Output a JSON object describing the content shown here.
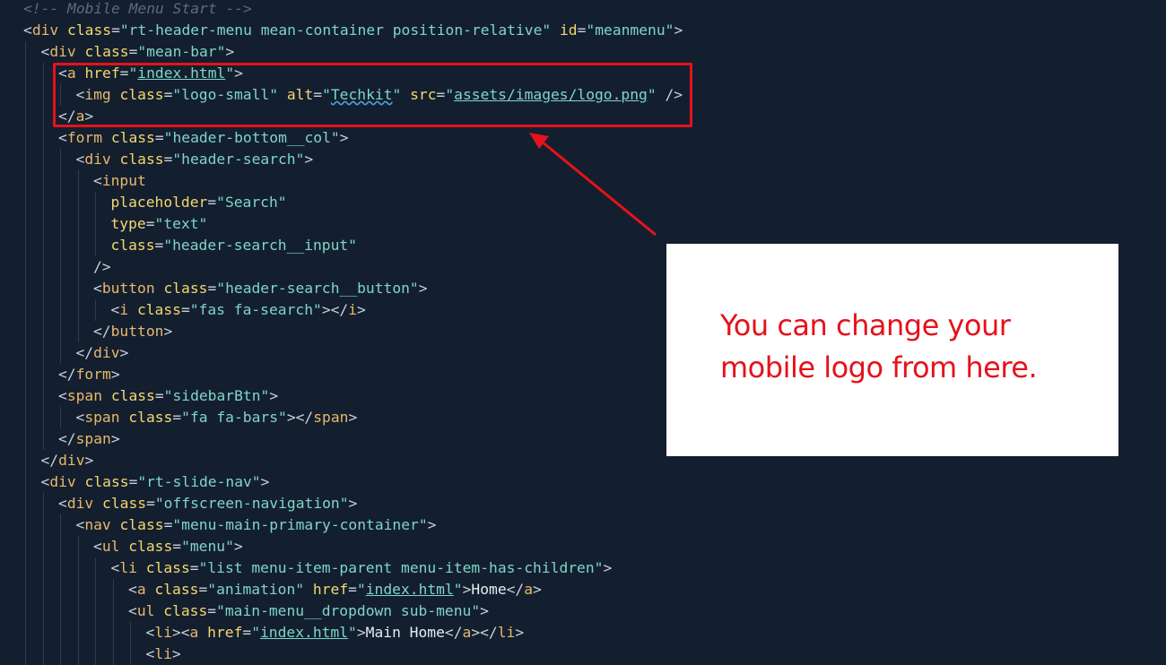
{
  "colors": {
    "background": "#131f2f",
    "tag": "#e8b86a",
    "attribute": "#f5d76e",
    "string": "#7fd5c8",
    "comment": "#5c6b7f",
    "annotation": "#e5121b",
    "callout_bg": "#ffffff"
  },
  "callout": {
    "line1": "You can change your",
    "line2": "mobile logo from here."
  },
  "code_lines": [
    {
      "indent": 0,
      "tokens": [
        [
          "cm",
          "<!-- Mobile Menu Start -->"
        ]
      ]
    },
    {
      "indent": 0,
      "tokens": [
        [
          "pu",
          "<"
        ],
        [
          "tg",
          "div"
        ],
        [
          "pu",
          " "
        ],
        [
          "at",
          "class"
        ],
        [
          "pu",
          "="
        ],
        [
          "st",
          "\"rt-header-menu mean-container position-relative\""
        ],
        [
          "pu",
          " "
        ],
        [
          "at",
          "id"
        ],
        [
          "pu",
          "="
        ],
        [
          "st",
          "\"meanmenu\""
        ],
        [
          "pu",
          ">"
        ]
      ]
    },
    {
      "indent": 1,
      "tokens": [
        [
          "pu",
          "<"
        ],
        [
          "tg",
          "div"
        ],
        [
          "pu",
          " "
        ],
        [
          "at",
          "class"
        ],
        [
          "pu",
          "="
        ],
        [
          "st",
          "\"mean-bar\""
        ],
        [
          "pu",
          ">"
        ]
      ]
    },
    {
      "indent": 2,
      "tokens": [
        [
          "pu",
          "<"
        ],
        [
          "tg",
          "a"
        ],
        [
          "pu",
          " "
        ],
        [
          "at",
          "href"
        ],
        [
          "pu",
          "="
        ],
        [
          "st",
          "\""
        ],
        [
          "st ul",
          "index.html"
        ],
        [
          "st",
          "\""
        ],
        [
          "pu",
          ">"
        ]
      ]
    },
    {
      "indent": 3,
      "tokens": [
        [
          "pu",
          "<"
        ],
        [
          "tg",
          "img"
        ],
        [
          "pu",
          " "
        ],
        [
          "at",
          "class"
        ],
        [
          "pu",
          "="
        ],
        [
          "st",
          "\"logo-small\""
        ],
        [
          "pu",
          " "
        ],
        [
          "at",
          "alt"
        ],
        [
          "pu",
          "="
        ],
        [
          "st",
          "\""
        ],
        [
          "st sq",
          "Techkit"
        ],
        [
          "st",
          "\""
        ],
        [
          "pu",
          " "
        ],
        [
          "at",
          "src"
        ],
        [
          "pu",
          "="
        ],
        [
          "st",
          "\""
        ],
        [
          "st ul",
          "assets/images/logo.png"
        ],
        [
          "st",
          "\""
        ],
        [
          "pu",
          " />"
        ]
      ]
    },
    {
      "indent": 2,
      "tokens": [
        [
          "pu",
          "</"
        ],
        [
          "tg",
          "a"
        ],
        [
          "pu",
          ">"
        ]
      ]
    },
    {
      "indent": 2,
      "tokens": [
        [
          "pu",
          "<"
        ],
        [
          "tg",
          "form"
        ],
        [
          "pu",
          " "
        ],
        [
          "at",
          "class"
        ],
        [
          "pu",
          "="
        ],
        [
          "st",
          "\"header-bottom__col\""
        ],
        [
          "pu",
          ">"
        ]
      ]
    },
    {
      "indent": 3,
      "tokens": [
        [
          "pu",
          "<"
        ],
        [
          "tg",
          "div"
        ],
        [
          "pu",
          " "
        ],
        [
          "at",
          "class"
        ],
        [
          "pu",
          "="
        ],
        [
          "st",
          "\"header-search\""
        ],
        [
          "pu",
          ">"
        ]
      ]
    },
    {
      "indent": 4,
      "tokens": [
        [
          "pu",
          "<"
        ],
        [
          "tg",
          "input"
        ]
      ]
    },
    {
      "indent": 5,
      "tokens": [
        [
          "at",
          "placeholder"
        ],
        [
          "pu",
          "="
        ],
        [
          "st",
          "\"Search\""
        ]
      ]
    },
    {
      "indent": 5,
      "tokens": [
        [
          "at",
          "type"
        ],
        [
          "pu",
          "="
        ],
        [
          "st",
          "\"text\""
        ]
      ]
    },
    {
      "indent": 5,
      "tokens": [
        [
          "at",
          "class"
        ],
        [
          "pu",
          "="
        ],
        [
          "st",
          "\"header-search__input\""
        ]
      ]
    },
    {
      "indent": 4,
      "tokens": [
        [
          "pu",
          "/>"
        ]
      ]
    },
    {
      "indent": 4,
      "tokens": [
        [
          "pu",
          "<"
        ],
        [
          "tg",
          "button"
        ],
        [
          "pu",
          " "
        ],
        [
          "at",
          "class"
        ],
        [
          "pu",
          "="
        ],
        [
          "st",
          "\"header-search__button\""
        ],
        [
          "pu",
          ">"
        ]
      ]
    },
    {
      "indent": 5,
      "tokens": [
        [
          "pu",
          "<"
        ],
        [
          "tg",
          "i"
        ],
        [
          "pu",
          " "
        ],
        [
          "at",
          "class"
        ],
        [
          "pu",
          "="
        ],
        [
          "st",
          "\"fas fa-search\""
        ],
        [
          "pu",
          "></"
        ],
        [
          "tg",
          "i"
        ],
        [
          "pu",
          ">"
        ]
      ]
    },
    {
      "indent": 4,
      "tokens": [
        [
          "pu",
          "</"
        ],
        [
          "tg",
          "button"
        ],
        [
          "pu",
          ">"
        ]
      ]
    },
    {
      "indent": 3,
      "tokens": [
        [
          "pu",
          "</"
        ],
        [
          "tg",
          "div"
        ],
        [
          "pu",
          ">"
        ]
      ]
    },
    {
      "indent": 2,
      "tokens": [
        [
          "pu",
          "</"
        ],
        [
          "tg",
          "form"
        ],
        [
          "pu",
          ">"
        ]
      ]
    },
    {
      "indent": 2,
      "tokens": [
        [
          "pu",
          "<"
        ],
        [
          "tg",
          "span"
        ],
        [
          "pu",
          " "
        ],
        [
          "at",
          "class"
        ],
        [
          "pu",
          "="
        ],
        [
          "st",
          "\"sidebarBtn\""
        ],
        [
          "pu",
          ">"
        ]
      ]
    },
    {
      "indent": 3,
      "tokens": [
        [
          "pu",
          "<"
        ],
        [
          "tg",
          "span"
        ],
        [
          "pu",
          " "
        ],
        [
          "at",
          "class"
        ],
        [
          "pu",
          "="
        ],
        [
          "st",
          "\"fa fa-bars\""
        ],
        [
          "pu",
          "></"
        ],
        [
          "tg",
          "span"
        ],
        [
          "pu",
          ">"
        ]
      ]
    },
    {
      "indent": 2,
      "tokens": [
        [
          "pu",
          "</"
        ],
        [
          "tg",
          "span"
        ],
        [
          "pu",
          ">"
        ]
      ]
    },
    {
      "indent": 1,
      "tokens": [
        [
          "pu",
          "</"
        ],
        [
          "tg",
          "div"
        ],
        [
          "pu",
          ">"
        ]
      ]
    },
    {
      "indent": 1,
      "tokens": [
        [
          "pu",
          "<"
        ],
        [
          "tg",
          "div"
        ],
        [
          "pu",
          " "
        ],
        [
          "at",
          "class"
        ],
        [
          "pu",
          "="
        ],
        [
          "st",
          "\"rt-slide-nav\""
        ],
        [
          "pu",
          ">"
        ]
      ]
    },
    {
      "indent": 2,
      "tokens": [
        [
          "pu",
          "<"
        ],
        [
          "tg",
          "div"
        ],
        [
          "pu",
          " "
        ],
        [
          "at",
          "class"
        ],
        [
          "pu",
          "="
        ],
        [
          "st",
          "\"offscreen-navigation\""
        ],
        [
          "pu",
          ">"
        ]
      ]
    },
    {
      "indent": 3,
      "tokens": [
        [
          "pu",
          "<"
        ],
        [
          "tg",
          "nav"
        ],
        [
          "pu",
          " "
        ],
        [
          "at",
          "class"
        ],
        [
          "pu",
          "="
        ],
        [
          "st",
          "\"menu-main-primary-container\""
        ],
        [
          "pu",
          ">"
        ]
      ]
    },
    {
      "indent": 4,
      "tokens": [
        [
          "pu",
          "<"
        ],
        [
          "tg",
          "ul"
        ],
        [
          "pu",
          " "
        ],
        [
          "at",
          "class"
        ],
        [
          "pu",
          "="
        ],
        [
          "st",
          "\"menu\""
        ],
        [
          "pu",
          ">"
        ]
      ]
    },
    {
      "indent": 5,
      "tokens": [
        [
          "pu",
          "<"
        ],
        [
          "tg",
          "li"
        ],
        [
          "pu",
          " "
        ],
        [
          "at",
          "class"
        ],
        [
          "pu",
          "="
        ],
        [
          "st",
          "\"list menu-item-parent menu-item-has-children\""
        ],
        [
          "pu",
          ">"
        ]
      ]
    },
    {
      "indent": 6,
      "tokens": [
        [
          "pu",
          "<"
        ],
        [
          "tg",
          "a"
        ],
        [
          "pu",
          " "
        ],
        [
          "at",
          "class"
        ],
        [
          "pu",
          "="
        ],
        [
          "st",
          "\"animation\""
        ],
        [
          "pu",
          " "
        ],
        [
          "at",
          "href"
        ],
        [
          "pu",
          "="
        ],
        [
          "st",
          "\""
        ],
        [
          "st ul",
          "index.html"
        ],
        [
          "st",
          "\""
        ],
        [
          "pu",
          ">"
        ],
        [
          "tx",
          "Home"
        ],
        [
          "pu",
          "</"
        ],
        [
          "tg",
          "a"
        ],
        [
          "pu",
          ">"
        ]
      ]
    },
    {
      "indent": 6,
      "tokens": [
        [
          "pu",
          "<"
        ],
        [
          "tg",
          "ul"
        ],
        [
          "pu",
          " "
        ],
        [
          "at",
          "class"
        ],
        [
          "pu",
          "="
        ],
        [
          "st",
          "\"main-menu__dropdown sub-menu\""
        ],
        [
          "pu",
          ">"
        ]
      ]
    },
    {
      "indent": 7,
      "tokens": [
        [
          "pu",
          "<"
        ],
        [
          "tg",
          "li"
        ],
        [
          "pu",
          "><"
        ],
        [
          "tg",
          "a"
        ],
        [
          "pu",
          " "
        ],
        [
          "at",
          "href"
        ],
        [
          "pu",
          "="
        ],
        [
          "st",
          "\""
        ],
        [
          "st ul",
          "index.html"
        ],
        [
          "st",
          "\""
        ],
        [
          "pu",
          ">"
        ],
        [
          "tx",
          "Main Home"
        ],
        [
          "pu",
          "</"
        ],
        [
          "tg",
          "a"
        ],
        [
          "pu",
          "></"
        ],
        [
          "tg",
          "li"
        ],
        [
          "pu",
          ">"
        ]
      ]
    },
    {
      "indent": 7,
      "tokens": [
        [
          "pu",
          "<"
        ],
        [
          "tg",
          "li"
        ],
        [
          "pu",
          ">"
        ]
      ]
    }
  ]
}
